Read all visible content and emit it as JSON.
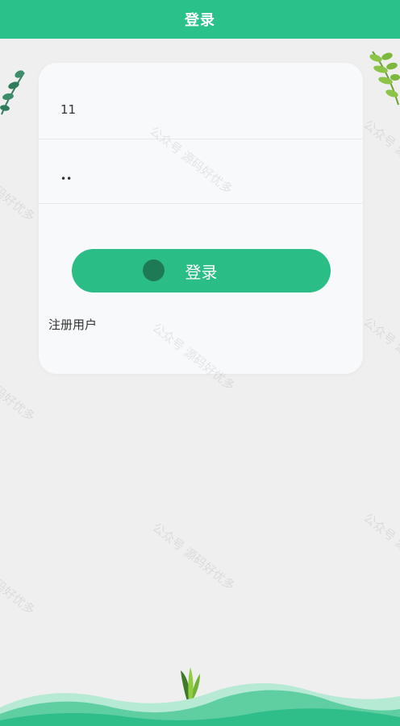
{
  "header": {
    "title": "登录"
  },
  "form": {
    "username_value": "11",
    "password_value": "12"
  },
  "buttons": {
    "login_label": "登录"
  },
  "links": {
    "register_label": "注册用户"
  },
  "watermark": {
    "text": "公众号 源码好优多"
  },
  "colors": {
    "brand": "#2ac18a",
    "button": "#2bbd86",
    "background": "#efefef",
    "card": "#f8f9fa"
  },
  "icons": [
    "leaf-decoration-icon",
    "leaf-decoration-icon",
    "plant-sprout-icon",
    "loading-dot-icon"
  ]
}
